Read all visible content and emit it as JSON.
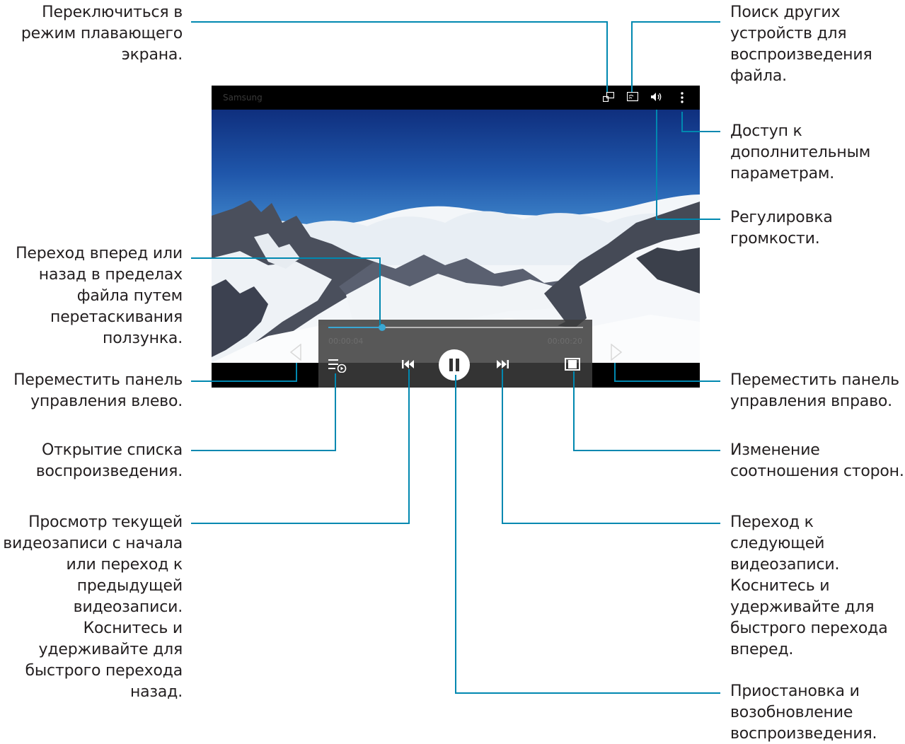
{
  "player": {
    "title": "Samsung",
    "time_elapsed": "00:00:04",
    "time_total": "00:00:20",
    "progress_fraction": 0.21,
    "icons": {
      "popup": "popup-window-icon",
      "cast": "screen-mirroring-icon",
      "volume": "volume-icon",
      "more": "more-options-icon",
      "playlist": "playlist-icon",
      "prev": "skip-previous-icon",
      "pause": "pause-icon",
      "next": "skip-next-icon",
      "ratio": "aspect-ratio-icon",
      "move_left": "move-left-arrow-icon",
      "move_right": "move-right-arrow-icon"
    }
  },
  "callouts": {
    "popup": "Переключиться в\nрежим плавающего\nэкрана.",
    "cast": "Поиск других\nустройств для\nвоспроизведения\nфайла.",
    "more": "Доступ к\nдополнительным\nпараметрам.",
    "volume": "Регулировка\nгромкости.",
    "seek": "Переход вперед или\nназад в пределах\nфайла путем\nперетаскивания\nползунка.",
    "move_left": "Переместить панель\nуправления влево.",
    "move_right": "Переместить панель\nуправления вправо.",
    "playlist": "Открытие списка\nвоспроизведения.",
    "ratio": "Изменение\nсоотношения сторон.",
    "prev": "Просмотр текущей\nвидеозаписи с начала\nили переход к\nпредыдущей\nвидеозаписи.\nКоснитесь и\nудерживайте для\nбыстрого перехода\nназад.",
    "next": "Переход к\nследующей\nвидеозаписи.\nКоснитесь и\nудерживайте для\nбыстрого перехода\nвперед.",
    "pause": "Приостановка и\nвозобновление\nвоспроизведения."
  },
  "colors": {
    "leader": "#0088b0",
    "seek_accent": "#3aa7d3",
    "text": "#231f20"
  }
}
